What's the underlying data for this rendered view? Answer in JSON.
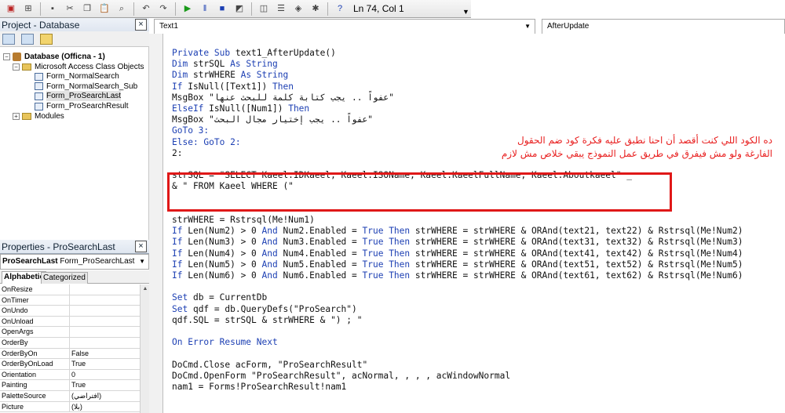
{
  "toolbar": {
    "icons": [
      "view-access-icon",
      "insert-module-icon",
      "save-icon",
      "cut-icon",
      "copy-icon",
      "paste-icon",
      "find-icon",
      "undo-icon",
      "redo-icon",
      "run-icon",
      "break-icon",
      "reset-icon",
      "design-mode-icon",
      "project-explorer-icon",
      "properties-icon",
      "object-browser-icon",
      "toolbox-icon",
      "help-icon"
    ],
    "status": "Ln 74, Col 1"
  },
  "project_panel": {
    "title": "Project - Database",
    "close": "×",
    "tree": [
      {
        "label": "Database (Officna - 1)",
        "level": 0,
        "type": "db",
        "bold": true,
        "expander": "−"
      },
      {
        "label": "Microsoft Access Class Objects",
        "level": 1,
        "type": "folder",
        "expander": "−"
      },
      {
        "label": "Form_NormalSearch",
        "level": 2,
        "type": "form"
      },
      {
        "label": "Form_NormalSearch_Sub",
        "level": 2,
        "type": "form"
      },
      {
        "label": "Form_ProSearchLast",
        "level": 2,
        "type": "form",
        "selected": true
      },
      {
        "label": "Form_ProSearchResult",
        "level": 2,
        "type": "form"
      },
      {
        "label": "Modules",
        "level": 1,
        "type": "folder",
        "expander": "+"
      }
    ]
  },
  "properties_panel": {
    "title": "Properties - ProSearchLast",
    "close": "×",
    "object_name": "ProSearchLast",
    "object_type": "Form_ProSearchLast",
    "tabs": [
      "Alphabetic",
      "Categorized"
    ],
    "rows": [
      {
        "name": "OnResize",
        "value": ""
      },
      {
        "name": "OnTimer",
        "value": ""
      },
      {
        "name": "OnUndo",
        "value": ""
      },
      {
        "name": "OnUnload",
        "value": ""
      },
      {
        "name": "OpenArgs",
        "value": ""
      },
      {
        "name": "OrderBy",
        "value": ""
      },
      {
        "name": "OrderByOn",
        "value": "False"
      },
      {
        "name": "OrderByOnLoad",
        "value": "True"
      },
      {
        "name": "Orientation",
        "value": "0"
      },
      {
        "name": "Painting",
        "value": "True"
      },
      {
        "name": "PaletteSource",
        "value": "(افتراضي)"
      },
      {
        "name": "Picture",
        "value": "(بلا)"
      }
    ]
  },
  "code_window": {
    "object_dropdown": "Text1",
    "procedure_dropdown": "AfterUpdate",
    "lines": [
      [
        {
          "t": "Private Sub ",
          "c": "kw"
        },
        {
          "t": "text1_AfterUpdate()"
        }
      ],
      [
        {
          "t": "Dim ",
          "c": "kw"
        },
        {
          "t": "strSQL "
        },
        {
          "t": "As String",
          "c": "kw"
        }
      ],
      [
        {
          "t": "Dim ",
          "c": "kw"
        },
        {
          "t": "strWHERE "
        },
        {
          "t": "As String",
          "c": "kw"
        }
      ],
      [
        {
          "t": "If ",
          "c": "kw"
        },
        {
          "t": "IsNull([Text1]) "
        },
        {
          "t": "Then",
          "c": "kw"
        }
      ],
      [
        {
          "t": "MsgBox \"عفواً .. يجب كتابة كلمة للبحث عنها\""
        }
      ],
      [
        {
          "t": "ElseIf ",
          "c": "kw"
        },
        {
          "t": "IsNull([Num1]) "
        },
        {
          "t": "Then",
          "c": "kw"
        }
      ],
      [
        {
          "t": "MsgBox \"عفواً .. يجب إختيار مجال البحث\""
        }
      ],
      [
        {
          "t": "GoTo 3:",
          "c": "kw"
        }
      ],
      [
        {
          "t": "Else: GoTo 2:",
          "c": "kw"
        }
      ],
      [
        {
          "t": "2:"
        }
      ],
      [
        {
          "t": ""
        }
      ],
      [
        {
          "t": "strSQL = \"SELECT Kaeel.IDKaeel, Kaeel.ISOName, Kaeel.KaeelFullName, Kaeel.Aboutkaeel\" _"
        }
      ],
      [
        {
          "t": "& \" FROM Kaeel WHERE (\""
        }
      ],
      [
        {
          "t": ""
        }
      ],
      [
        {
          "t": ""
        }
      ],
      [
        {
          "t": "strWHERE = Rstrsql(Me!Num1)"
        }
      ],
      [
        {
          "t": "If ",
          "c": "kw"
        },
        {
          "t": "Len(Num2) > 0 "
        },
        {
          "t": "And ",
          "c": "kw"
        },
        {
          "t": "Num2.Enabled = "
        },
        {
          "t": "True Then ",
          "c": "kw"
        },
        {
          "t": "strWHERE = strWHERE & ORAnd(text21, text22) & Rstrsql(Me!Num2)"
        }
      ],
      [
        {
          "t": "If ",
          "c": "kw"
        },
        {
          "t": "Len(Num3) > 0 "
        },
        {
          "t": "And ",
          "c": "kw"
        },
        {
          "t": "Num3.Enabled = "
        },
        {
          "t": "True Then ",
          "c": "kw"
        },
        {
          "t": "strWHERE = strWHERE & ORAnd(text31, text32) & Rstrsql(Me!Num3)"
        }
      ],
      [
        {
          "t": "If ",
          "c": "kw"
        },
        {
          "t": "Len(Num4) > 0 "
        },
        {
          "t": "And ",
          "c": "kw"
        },
        {
          "t": "Num4.Enabled = "
        },
        {
          "t": "True Then ",
          "c": "kw"
        },
        {
          "t": "strWHERE = strWHERE & ORAnd(text41, text42) & Rstrsql(Me!Num4)"
        }
      ],
      [
        {
          "t": "If ",
          "c": "kw"
        },
        {
          "t": "Len(Num5) > 0 "
        },
        {
          "t": "And ",
          "c": "kw"
        },
        {
          "t": "Num5.Enabled = "
        },
        {
          "t": "True Then ",
          "c": "kw"
        },
        {
          "t": "strWHERE = strWHERE & ORAnd(text51, text52) & Rstrsql(Me!Num5)"
        }
      ],
      [
        {
          "t": "If ",
          "c": "kw"
        },
        {
          "t": "Len(Num6) > 0 "
        },
        {
          "t": "And ",
          "c": "kw"
        },
        {
          "t": "Num6.Enabled = "
        },
        {
          "t": "True Then ",
          "c": "kw"
        },
        {
          "t": "strWHERE = strWHERE & ORAnd(text61, text62) & Rstrsql(Me!Num6)"
        }
      ],
      [
        {
          "t": ""
        }
      ],
      [
        {
          "t": "Set ",
          "c": "kw"
        },
        {
          "t": "db = CurrentDb"
        }
      ],
      [
        {
          "t": "Set ",
          "c": "kw"
        },
        {
          "t": "qdf = db.QueryDefs(\"ProSearch\")"
        }
      ],
      [
        {
          "t": "qdf.SQL = strSQL & strWHERE & \") ; \""
        }
      ],
      [
        {
          "t": ""
        }
      ],
      [
        {
          "t": "On Error Resume Next",
          "c": "kw"
        }
      ],
      [
        {
          "t": ""
        }
      ],
      [
        {
          "t": "DoCmd.Close acForm, \"ProSearchResult\""
        }
      ],
      [
        {
          "t": "DoCmd.OpenForm \"ProSearchResult\", acNormal, , , , acWindowNormal"
        }
      ],
      [
        {
          "t": "nam1 = Forms!ProSearchResult!nam1"
        }
      ]
    ]
  },
  "annotation": {
    "line1": "ده الكود اللي كنت أقصد أن احنا نطبق عليه فكرة كود ضم الحقول",
    "line2": "الفارغة ولو مش فيفرق في طريق عمل النموذج يبقي خلاص مش لازم",
    "color": "#e82020"
  }
}
